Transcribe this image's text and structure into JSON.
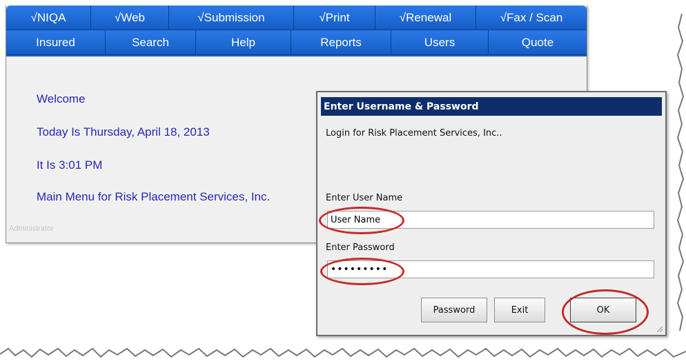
{
  "nav": {
    "row1": [
      "√NIQA",
      "√Web",
      "√Submission",
      "√Print",
      "√Renewal",
      "√Fax / Scan"
    ],
    "row2": [
      "Insured",
      "Search",
      "Help",
      "Reports",
      "Users",
      "Quote"
    ]
  },
  "welcome": {
    "greeting": "Welcome",
    "date": "Today Is Thursday, April 18, 2013",
    "time": "It Is 3:01 PM",
    "menu_title": "Main Menu for Risk Placement Services, Inc."
  },
  "admin_label": "Administrator",
  "dialog": {
    "title": "Enter Username & Password",
    "login_text": "Login for Risk Placement Services, Inc..",
    "username_label": "Enter User Name",
    "username_value": "User Name",
    "password_label": "Enter Password",
    "password_value": "•••••••••",
    "buttons": {
      "password": "Password",
      "exit": "Exit",
      "ok": "OK"
    }
  },
  "colors": {
    "nav_blue": "#1f6ad6",
    "welcome_text": "#2727b6",
    "dialog_title_bg": "#0e2d6b",
    "highlight_red": "#c42a2a"
  }
}
